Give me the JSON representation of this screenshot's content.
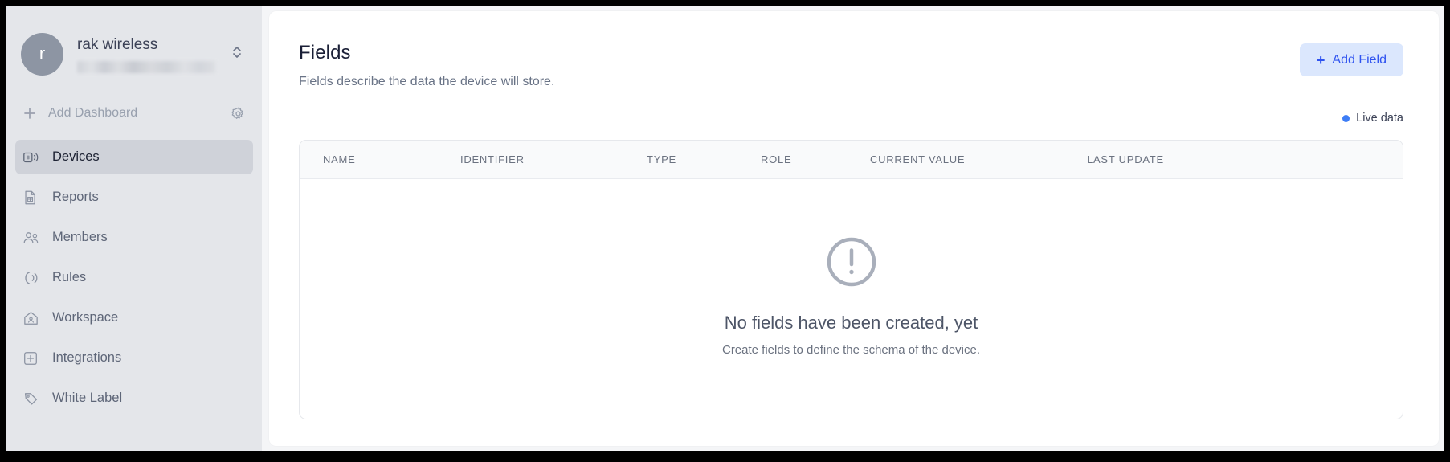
{
  "sidebar": {
    "workspace": {
      "avatar_initial": "r",
      "name": "rak wireless",
      "subtitle_redacted": true,
      "switcher_icon": "chevron-up-down-icon"
    },
    "add_dashboard": {
      "label": "Add Dashboard",
      "plus_icon": "plus-icon",
      "settings_icon": "gear-icon"
    },
    "items": [
      {
        "label": "Devices",
        "icon": "devices-icon",
        "active": true
      },
      {
        "label": "Reports",
        "icon": "report-icon",
        "active": false
      },
      {
        "label": "Members",
        "icon": "members-icon",
        "active": false
      },
      {
        "label": "Rules",
        "icon": "rules-icon",
        "active": false
      },
      {
        "label": "Workspace",
        "icon": "workspace-icon",
        "active": false
      },
      {
        "label": "Integrations",
        "icon": "integrations-icon",
        "active": false
      },
      {
        "label": "White Label",
        "icon": "tag-icon",
        "active": false
      }
    ]
  },
  "main": {
    "title": "Fields",
    "subtitle": "Fields describe the data the device will store.",
    "add_field_button": {
      "label": "Add Field",
      "plus_icon": "plus-icon"
    },
    "live_data": {
      "label": "Live data",
      "dot_color": "#3d7df6"
    },
    "table": {
      "columns": [
        "NAME",
        "IDENTIFIER",
        "TYPE",
        "ROLE",
        "CURRENT VALUE",
        "LAST UPDATE"
      ],
      "rows": []
    },
    "empty_state": {
      "icon": "exclamation-circle-icon",
      "title": "No fields have been created, yet",
      "subtitle": "Create fields to define the schema of the device."
    }
  },
  "colors": {
    "accent_blue": "#2f53f0",
    "accent_blue_bg": "#dbe7fd",
    "sidebar_bg": "#e4e6ea",
    "sidebar_active": "#cfd2d9",
    "page_bg": "#f4f5f7"
  }
}
